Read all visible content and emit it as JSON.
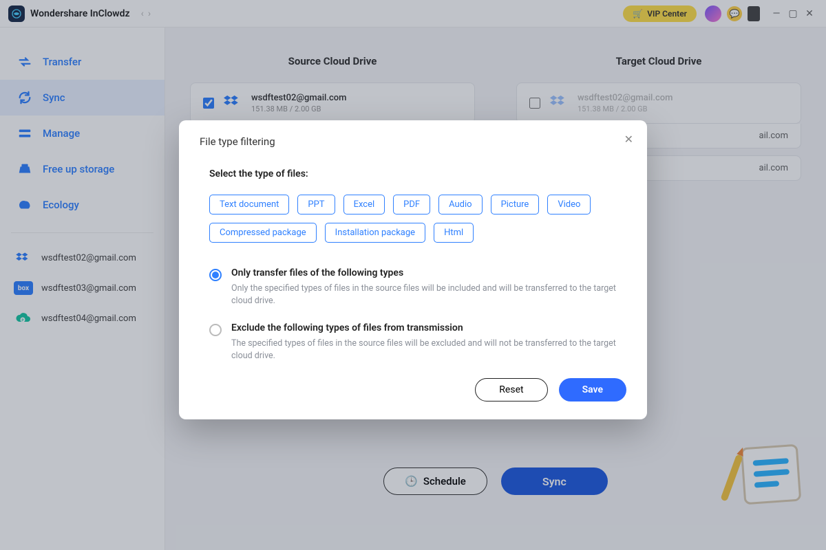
{
  "app": {
    "title": "Wondershare InClowdz"
  },
  "titlebar": {
    "vip_label": "VIP Center"
  },
  "sidebar": {
    "items": [
      {
        "label": "Transfer"
      },
      {
        "label": "Sync"
      },
      {
        "label": "Manage"
      },
      {
        "label": "Free up storage"
      },
      {
        "label": "Ecology"
      }
    ],
    "accounts": [
      {
        "email": "wsdftest02@gmail.com",
        "service": "dropbox"
      },
      {
        "email": "wsdftest03@gmail.com",
        "service": "box"
      },
      {
        "email": "wsdftest04@gmail.com",
        "service": "pcloud"
      }
    ]
  },
  "main": {
    "source_header": "Source Cloud Drive",
    "target_header": "Target Cloud Drive",
    "source_account": {
      "email": "wsdftest02@gmail.com",
      "usage": "151.38 MB / 2.00 GB",
      "checked": true
    },
    "target_account": {
      "email": "wsdftest02@gmail.com",
      "usage": "151.38 MB / 2.00 GB",
      "checked": false
    },
    "target_partial_rows": [
      "ail.com",
      "ail.com"
    ],
    "schedule_label": "Schedule",
    "sync_label": "Sync"
  },
  "modal": {
    "title": "File type filtering",
    "subtitle": "Select the type of files:",
    "chips": [
      "Text document",
      "PPT",
      "Excel",
      "PDF",
      "Audio",
      "Picture",
      "Video",
      "Compressed package",
      "Installation package",
      "Html"
    ],
    "option1": {
      "label": "Only transfer files of the following types",
      "desc": "Only the specified types of files in the source files will be included and will be transferred to the target cloud drive."
    },
    "option2": {
      "label": "Exclude the following types of files from transmission",
      "desc": "The specified types of files in the source files will be excluded and will not be transferred to the target cloud drive."
    },
    "selected_option": 1,
    "reset_label": "Reset",
    "save_label": "Save"
  }
}
